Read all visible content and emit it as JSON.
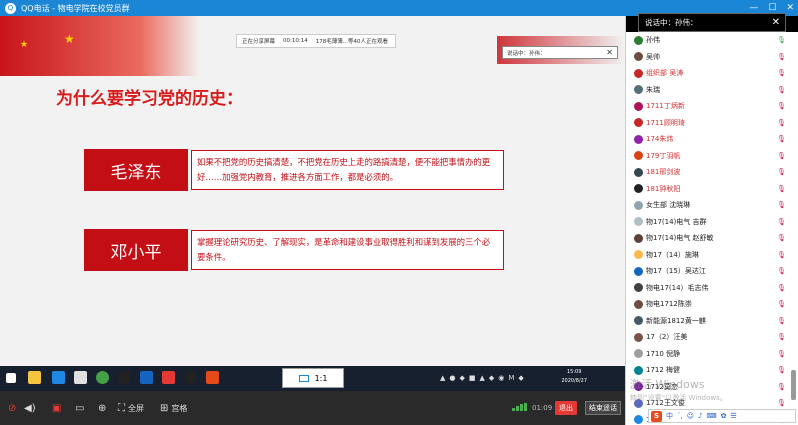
{
  "titlebar": {
    "app_name": "QQ电话",
    "separator": "-",
    "group_name": "物电学院在校党员群",
    "min_icon": "minimize-icon",
    "max_icon": "maximize-icon",
    "close_icon": "close-icon"
  },
  "share": {
    "status": "正在分享屏幕",
    "elapsed": "00:10:14",
    "viewers": "178毛薄薄...等40人正在观看",
    "slide_title": "为什么要学习党的历史：",
    "cards": [
      {
        "name": "毛泽东",
        "quote": "如果不把党的历史搞清楚，不把党在历史上走的路搞清楚，便不能把事情办的更好……加强党内教育，推进各方面工作，都是必须的。"
      },
      {
        "name": "邓小平",
        "quote": "掌握理论研究历史、了解现实，是革命和建设事业取得胜利和谋到发展的三个必要条件。"
      }
    ],
    "mini_speaking": "说话中：孙伟："
  },
  "taskbar": {
    "zoom": "1:1",
    "time": "15:09",
    "date": "2020/8/27"
  },
  "controls": {
    "fullscreen": "全屏",
    "grid": "宫格",
    "timer": "01:09",
    "hangup": "退出",
    "end_share": "结束遥话"
  },
  "panel": {
    "speaking": "说话中：孙伟：",
    "members": [
      {
        "name": "孙伟",
        "red": false,
        "color": "#2e7d32"
      },
      {
        "name": "吴帅",
        "red": false,
        "color": "#6d4c41"
      },
      {
        "name": "组织部 吴涛",
        "red": true,
        "color": "#c62828"
      },
      {
        "name": "朱瑞",
        "red": false,
        "color": "#546e7a"
      },
      {
        "name": "1711丁炳新",
        "red": true,
        "color": "#ad1457"
      },
      {
        "name": "1711顾明琦",
        "red": true,
        "color": "#c62828"
      },
      {
        "name": "174朱炜",
        "red": true,
        "color": "#8e24aa"
      },
      {
        "name": "179丁羽帆",
        "red": true,
        "color": "#d84315"
      },
      {
        "name": "181邢剑波",
        "red": true,
        "color": "#37474f"
      },
      {
        "name": "181钟秋阳",
        "red": true,
        "color": "#212121"
      },
      {
        "name": "女生部 沈晓琳",
        "red": false,
        "color": "#90a4ae"
      },
      {
        "name": "物17(14)电气 吉群",
        "red": false,
        "color": "#b0bec5"
      },
      {
        "name": "物17(14)电气 赵舒敏",
        "red": false,
        "color": "#5d4037"
      },
      {
        "name": "物17（14）施琳",
        "red": false,
        "color": "#ffb74d"
      },
      {
        "name": "物17（15）吴达江",
        "red": false,
        "color": "#1565c0"
      },
      {
        "name": "物电17(14）毛志伟",
        "red": false,
        "color": "#424242"
      },
      {
        "name": "物电1712陈崇",
        "red": false,
        "color": "#6d4c41"
      },
      {
        "name": "新能源1812黄一麒",
        "red": false,
        "color": "#455a64"
      },
      {
        "name": "17（2）汪美",
        "red": false,
        "color": "#795548"
      },
      {
        "name": "1710 倪静",
        "red": false,
        "color": "#9e9e9e"
      },
      {
        "name": "1712 梅健",
        "red": false,
        "color": "#00838f"
      },
      {
        "name": "1712莫恋",
        "red": false,
        "color": "#7b1fa2"
      },
      {
        "name": "1712王文俊",
        "red": false,
        "color": "#5c6bc0"
      },
      {
        "name": "1713",
        "red": false,
        "color": "#1e88e5"
      }
    ]
  },
  "watermark": {
    "line1": "激活 Windows",
    "line2": "转到“设置”以激活 Windows。"
  },
  "ime": {
    "brand": "S",
    "lang": "中"
  },
  "colors": {
    "titlebar": "#1b85d6",
    "accent_red": "#c40e15",
    "hangup": "#e53935"
  }
}
